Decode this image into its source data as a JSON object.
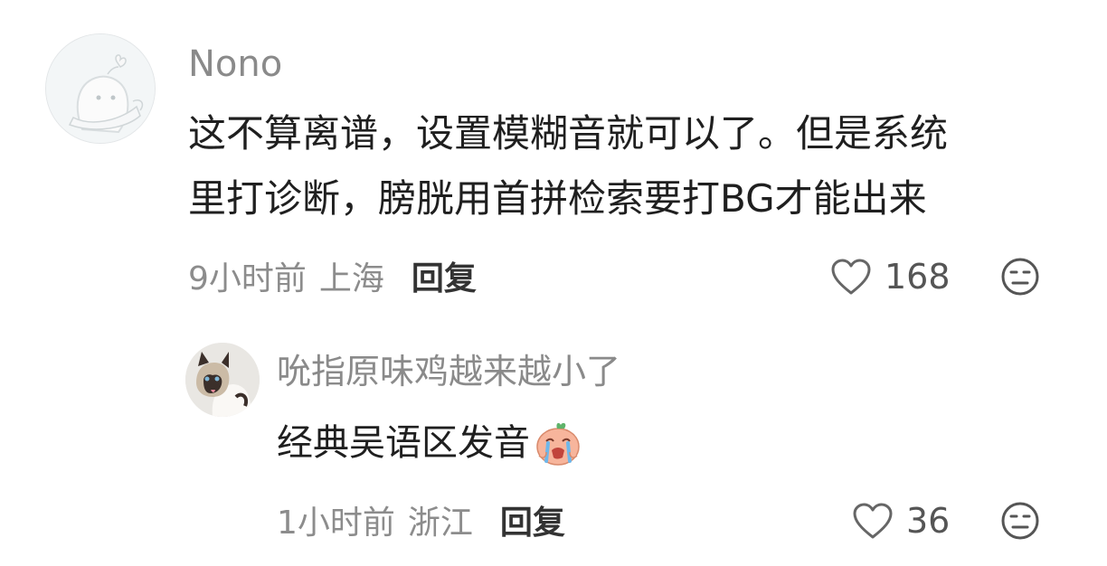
{
  "comments": [
    {
      "username": "Nono",
      "avatar_icon": "mascot-avatar",
      "text_line1": "这不算离谱，设置模糊音就可以了。但是系统",
      "text_line2": "里打诊断，膀胱用首拼检索要打BG才能出来",
      "time": "9小时前",
      "location": "上海",
      "reply_label": "回复",
      "like_count": "168",
      "reaction_icon": "meh-face-icon"
    },
    {
      "username": "吮指原味鸡越来越小了",
      "avatar_icon": "siamese-cat-avatar",
      "text": "经典吴语区发音",
      "inline_emoji": "crying-peach-emoji",
      "time": "1小时前",
      "location": "浙江",
      "reply_label": "回复",
      "like_count": "36",
      "reaction_icon": "meh-face-icon"
    }
  ]
}
